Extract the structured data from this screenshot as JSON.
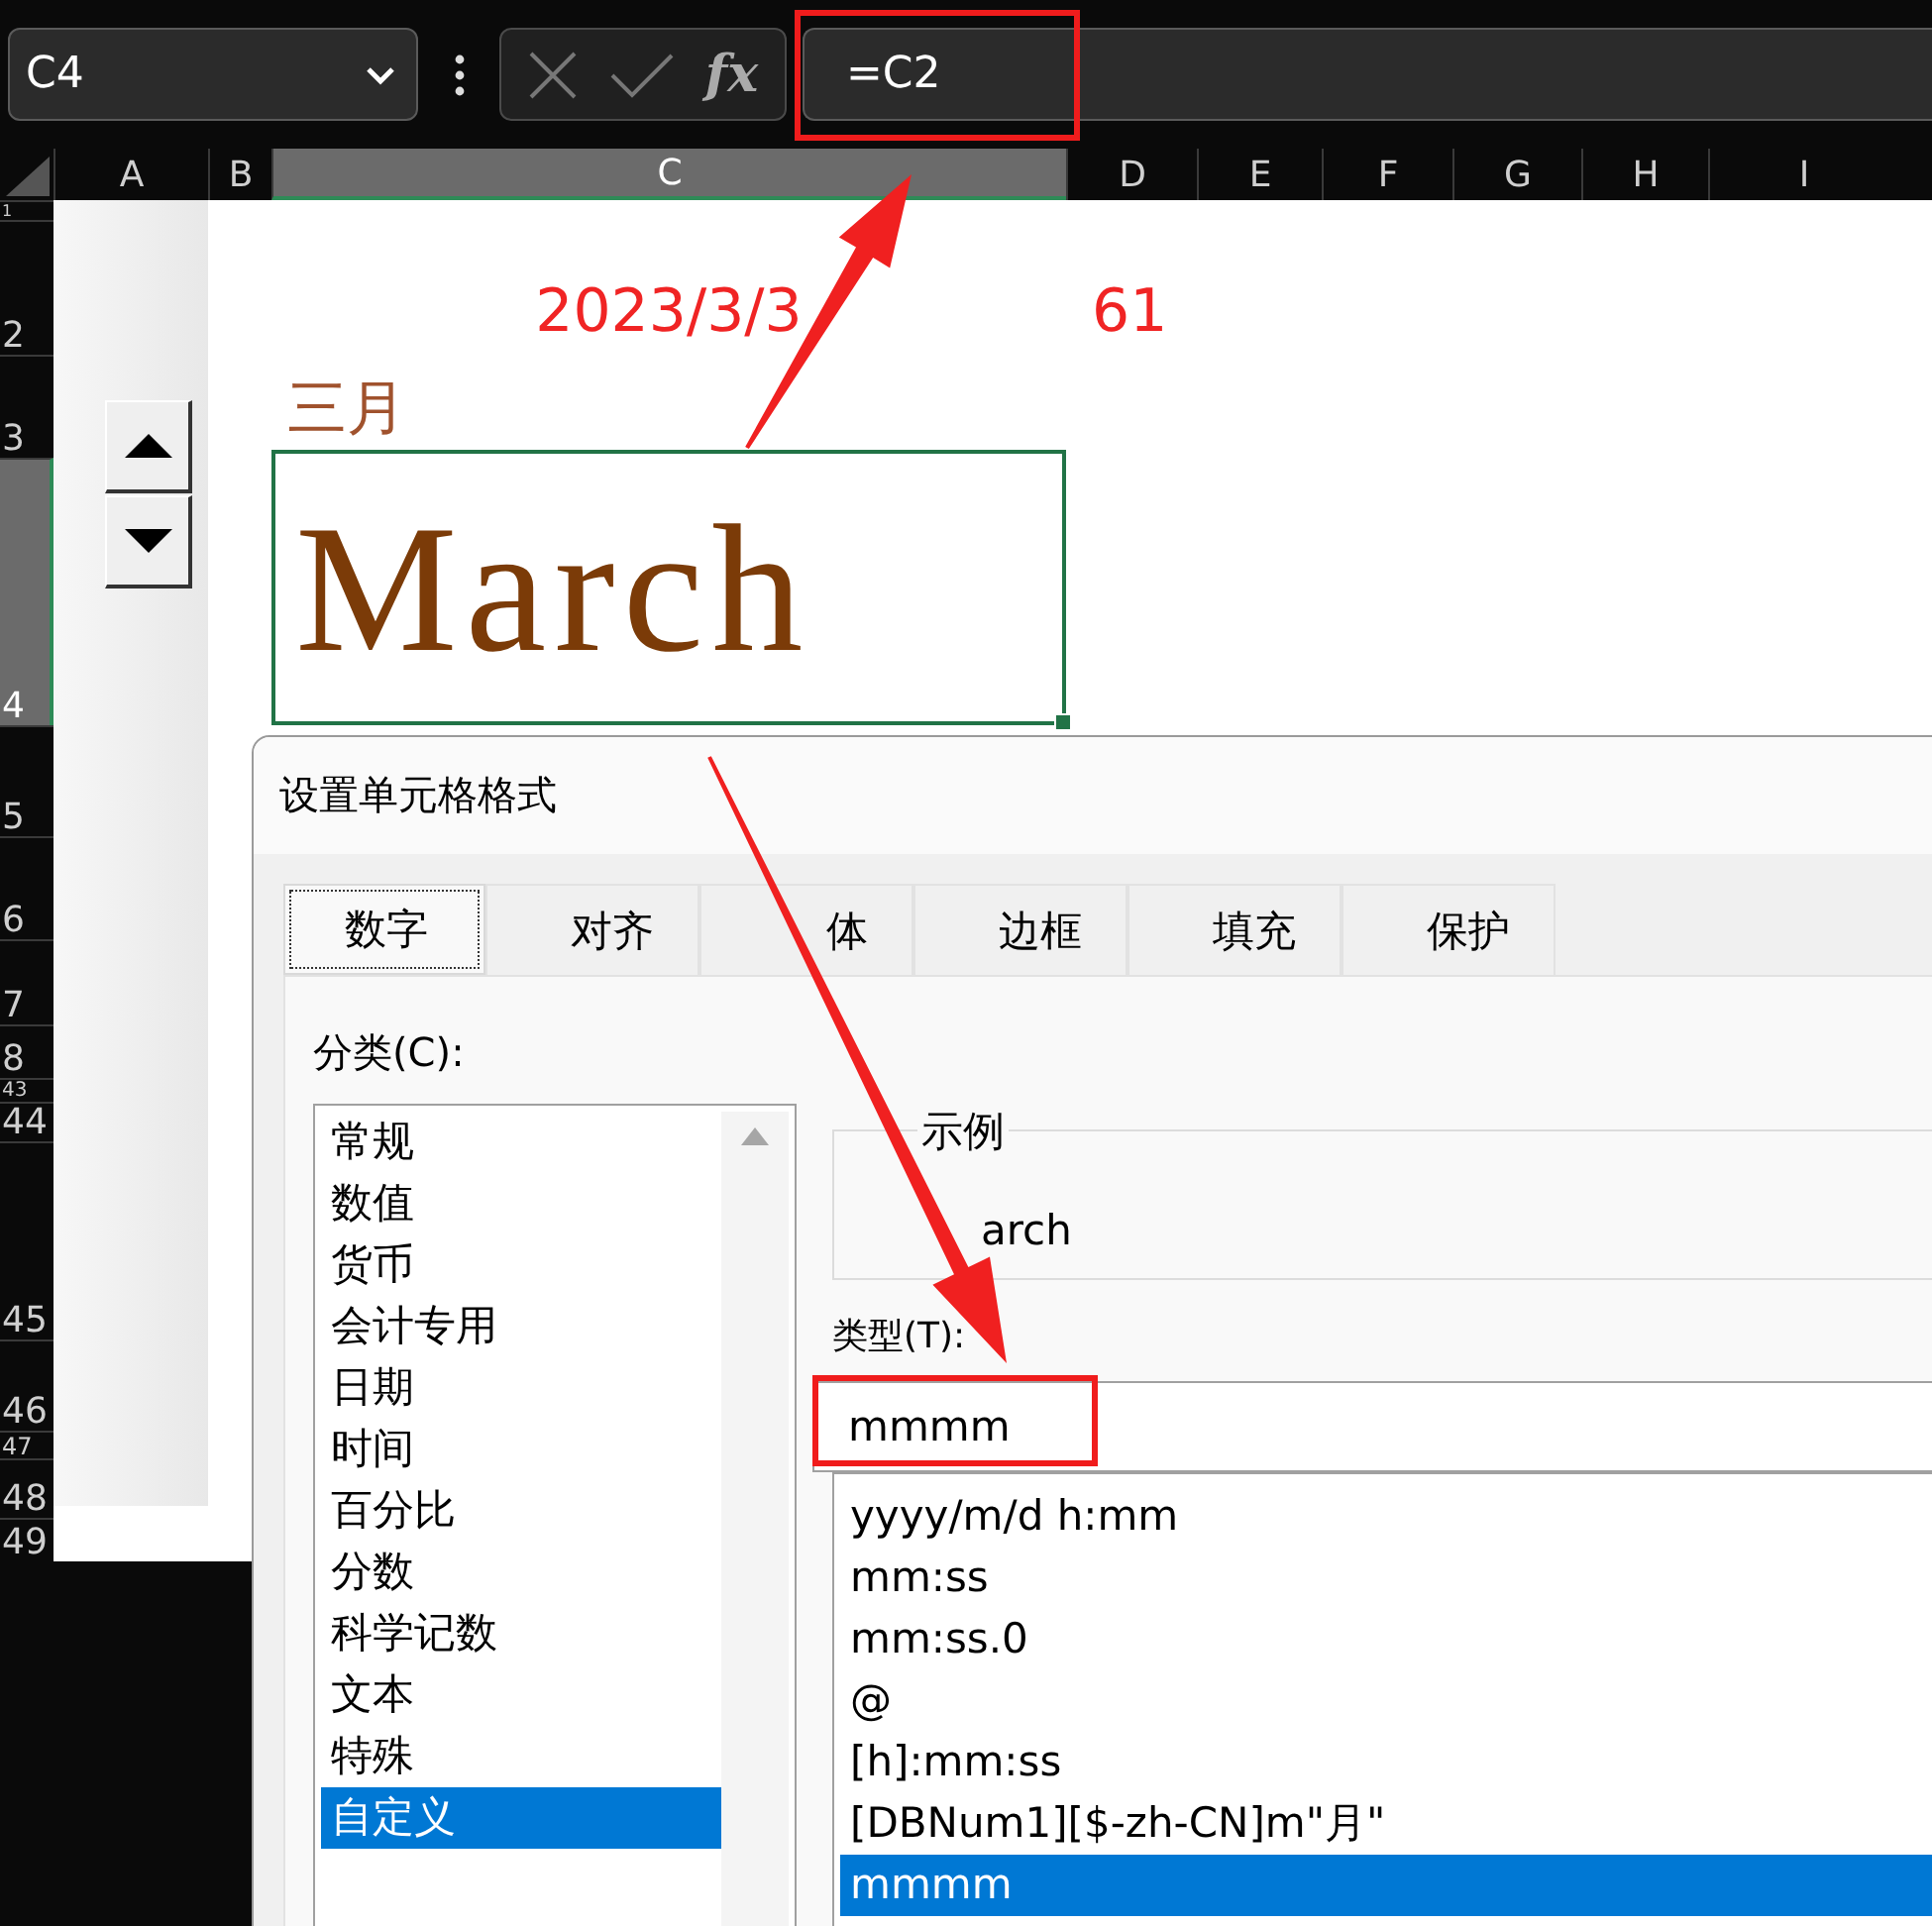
{
  "name_box": {
    "value": "C4"
  },
  "formula_buttons": {
    "function_label": "fx"
  },
  "formula": {
    "value": "=C2"
  },
  "columns": [
    {
      "label": "A",
      "selected": false
    },
    {
      "label": "B",
      "selected": false
    },
    {
      "label": "C",
      "selected": true
    },
    {
      "label": "D",
      "selected": false
    },
    {
      "label": "E",
      "selected": false
    },
    {
      "label": "F",
      "selected": false
    },
    {
      "label": "G",
      "selected": false
    },
    {
      "label": "H",
      "selected": false
    },
    {
      "label": "I",
      "selected": false
    }
  ],
  "rows": [
    {
      "label": "1",
      "selected": false
    },
    {
      "label": "2",
      "selected": false
    },
    {
      "label": "3",
      "selected": false
    },
    {
      "label": "4",
      "selected": true
    },
    {
      "label": "5",
      "selected": false
    },
    {
      "label": "6",
      "selected": false
    },
    {
      "label": "7",
      "selected": false
    },
    {
      "label": "8",
      "selected": false
    },
    {
      "label": "43",
      "selected": false
    },
    {
      "label": "44",
      "selected": false
    },
    {
      "label": "45",
      "selected": false
    },
    {
      "label": "46",
      "selected": false
    },
    {
      "label": "47",
      "selected": false
    },
    {
      "label": "48",
      "selected": false
    },
    {
      "label": "49",
      "selected": false
    }
  ],
  "sheet": {
    "date": "2023/3/3",
    "number": "61",
    "month_label": "三月",
    "active_cell": "March"
  },
  "dialog": {
    "title": "设置单元格格式",
    "tabs": [
      {
        "label": "数字",
        "selected": true
      },
      {
        "label": "对齐",
        "selected": false
      },
      {
        "label": "体",
        "selected": false
      },
      {
        "label": "边框",
        "selected": false
      },
      {
        "label": "填充",
        "selected": false
      },
      {
        "label": "保护",
        "selected": false
      }
    ],
    "category_label": "分类(C):",
    "categories": [
      {
        "label": "常规",
        "selected": false
      },
      {
        "label": "数值",
        "selected": false
      },
      {
        "label": "货币",
        "selected": false
      },
      {
        "label": "会计专用",
        "selected": false
      },
      {
        "label": "日期",
        "selected": false
      },
      {
        "label": "时间",
        "selected": false
      },
      {
        "label": "百分比",
        "selected": false
      },
      {
        "label": "分数",
        "selected": false
      },
      {
        "label": "科学记数",
        "selected": false
      },
      {
        "label": "文本",
        "selected": false
      },
      {
        "label": "特殊",
        "selected": false
      },
      {
        "label": "自定义",
        "selected": true
      }
    ],
    "sample_label": "示例",
    "sample": "arch",
    "type_label": "类型(T):",
    "type_value": "mmmm",
    "types": [
      {
        "label": "yyyy/m/d h:mm",
        "selected": false
      },
      {
        "label": "mm:ss",
        "selected": false
      },
      {
        "label": "mm:ss.0",
        "selected": false
      },
      {
        "label": "@",
        "selected": false
      },
      {
        "label": "[h]:mm:ss",
        "selected": false
      },
      {
        "label": "[DBNum1][$-zh-CN]m\"月\"",
        "selected": false
      },
      {
        "label": "mmmm",
        "selected": true
      }
    ]
  }
}
